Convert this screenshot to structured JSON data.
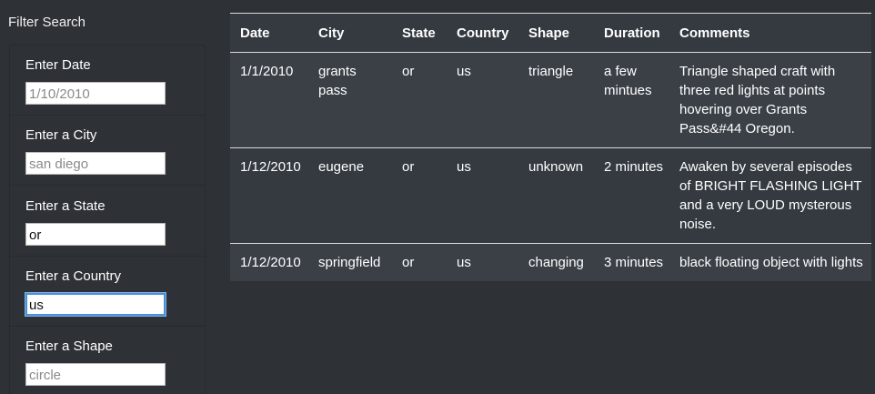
{
  "sidebar": {
    "title": "Filter Search",
    "filters": [
      {
        "label": "Enter Date",
        "placeholder": "1/10/2010",
        "value": ""
      },
      {
        "label": "Enter a City",
        "placeholder": "san diego",
        "value": ""
      },
      {
        "label": "Enter a State",
        "placeholder": "",
        "value": "or"
      },
      {
        "label": "Enter a Country",
        "placeholder": "",
        "value": "us"
      },
      {
        "label": "Enter a Shape",
        "placeholder": "circle",
        "value": ""
      }
    ]
  },
  "table": {
    "headers": [
      "Date",
      "City",
      "State",
      "Country",
      "Shape",
      "Duration",
      "Comments"
    ],
    "rows": [
      [
        "1/1/2010",
        "grants pass",
        "or",
        "us",
        "triangle",
        "a few mintues",
        "Triangle shaped craft with three red lights at points hovering over Grants Pass&#44 Oregon."
      ],
      [
        "1/12/2010",
        "eugene",
        "or",
        "us",
        "unknown",
        "2 minutes",
        "Awaken by several episodes of BRIGHT FLASHING LIGHT and a very LOUD mysterous noise."
      ],
      [
        "1/12/2010",
        "springfield",
        "or",
        "us",
        "changing",
        "3 minutes",
        "black floating object with lights"
      ]
    ]
  },
  "colors": {
    "background": "#2e3237",
    "table_background": "#343a40",
    "focus_ring": "#4a90d9"
  }
}
